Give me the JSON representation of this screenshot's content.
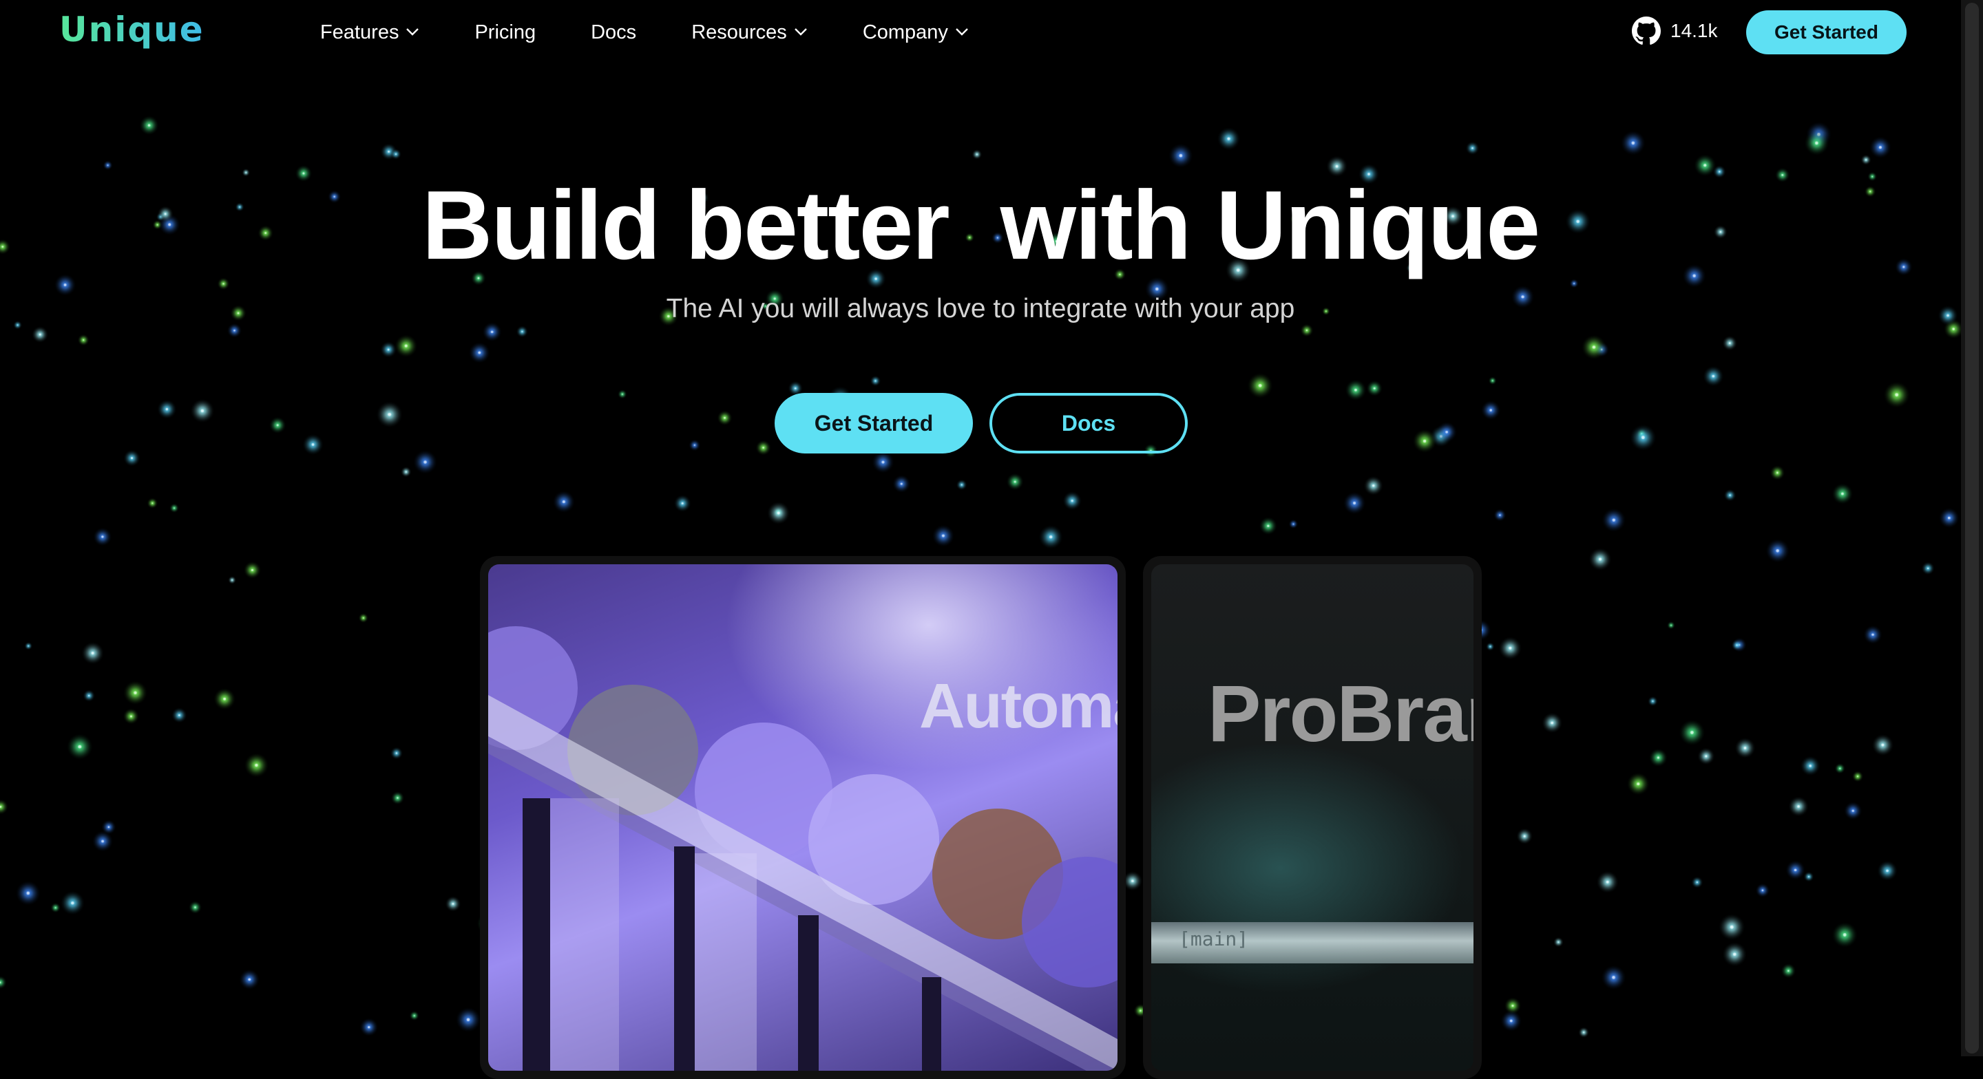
{
  "brand": {
    "logo": "Unique",
    "accent": "#5ee0f3",
    "logo_gradient": [
      "#58e69a",
      "#3fbbe8"
    ]
  },
  "nav": {
    "items": [
      {
        "label": "Features",
        "has_dropdown": true
      },
      {
        "label": "Pricing",
        "has_dropdown": false
      },
      {
        "label": "Docs",
        "has_dropdown": false
      },
      {
        "label": "Resources",
        "has_dropdown": true
      },
      {
        "label": "Company",
        "has_dropdown": true
      }
    ],
    "github_stars": "14.1k",
    "github_icon": "github-icon",
    "cta": "Get Started"
  },
  "hero": {
    "title": "Build better  with Unique",
    "subtitle": "The AI you will always love to integrate with your app",
    "primary_cta": "Get Started",
    "secondary_cta": "Docs"
  },
  "showcase": {
    "cards": [
      {
        "word": "Automa"
      },
      {
        "word": "ProBrar",
        "code": "[main]"
      }
    ]
  }
}
